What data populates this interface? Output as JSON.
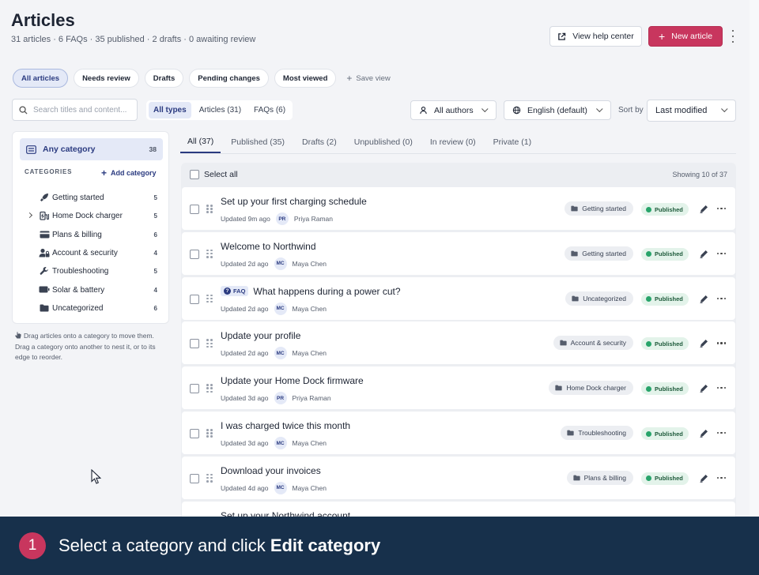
{
  "header": {
    "title": "Articles",
    "subtitle": "31 articles · 6 FAQs · 35 published · 2 drafts · 0 awaiting review",
    "help_label": "View help center",
    "new_label": "New article"
  },
  "views": {
    "items": [
      "All articles",
      "Needs review",
      "Drafts",
      "Pending changes",
      "Most viewed"
    ],
    "active": "All articles",
    "save_label": "Save view"
  },
  "filters": {
    "search_placeholder": "Search titles and content...",
    "types": [
      "All types",
      "Articles (31)",
      "FAQs (6)"
    ],
    "authors": "All authors",
    "language": "English (default)",
    "sort_label": "Sort by",
    "sort_value": "Last modified"
  },
  "sidebar": {
    "any_label": "Any category",
    "any_count": "38",
    "categories_heading": "CATEGORIES",
    "add_label": "Add category",
    "items": [
      {
        "label": "Getting started",
        "count": "5",
        "icon": "rocket-icon"
      },
      {
        "label": "Home Dock charger",
        "count": "5",
        "icon": "charger-icon"
      },
      {
        "label": "Plans & billing",
        "count": "6",
        "icon": "credit-card-icon"
      },
      {
        "label": "Account & security",
        "count": "4",
        "icon": "user-lock-icon"
      },
      {
        "label": "Troubleshooting",
        "count": "5",
        "icon": "wrench-icon"
      },
      {
        "label": "Solar & battery",
        "count": "4",
        "icon": "battery-icon"
      },
      {
        "label": "Uncategorized",
        "count": "6",
        "icon": "folder-icon"
      }
    ],
    "drag_hint": "Drag articles onto a category to move them. Drag a category onto another to nest it, or to its edge to reorder."
  },
  "status_tabs": [
    "All (37)",
    "Published (35)",
    "Drafts (2)",
    "Unpublished (0)",
    "In review (0)",
    "Private (1)"
  ],
  "list": {
    "select_all": "Select all",
    "showing": "Showing 10 of 37",
    "rows": [
      {
        "title": "Set up your first charging schedule",
        "updated": "Updated 9m ago",
        "initials": "PR",
        "author": "Priya Raman",
        "category": "Getting started",
        "status": "Published",
        "faq": false
      },
      {
        "title": "Welcome to Northwind",
        "updated": "Updated 2d ago",
        "initials": "MC",
        "author": "Maya Chen",
        "category": "Getting started",
        "status": "Published",
        "faq": false
      },
      {
        "title": "What happens during a power cut?",
        "updated": "Updated 2d ago",
        "initials": "MC",
        "author": "Maya Chen",
        "category": "Uncategorized",
        "status": "Published",
        "faq": true,
        "faq_label": "FAQ"
      },
      {
        "title": "Update your profile",
        "updated": "Updated 2d ago",
        "initials": "MC",
        "author": "Maya Chen",
        "category": "Account & security",
        "status": "Published",
        "faq": false
      },
      {
        "title": "Update your Home Dock firmware",
        "updated": "Updated 3d ago",
        "initials": "PR",
        "author": "Priya Raman",
        "category": "Home Dock charger",
        "status": "Published",
        "faq": false
      },
      {
        "title": "I was charged twice this month",
        "updated": "Updated 3d ago",
        "initials": "MC",
        "author": "Maya Chen",
        "category": "Troubleshooting",
        "status": "Published",
        "faq": false
      },
      {
        "title": "Download your invoices",
        "updated": "Updated 4d ago",
        "initials": "MC",
        "author": "Maya Chen",
        "category": "Plans & billing",
        "status": "Published",
        "faq": false
      },
      {
        "title": "Set up your Northwind account",
        "updated": "",
        "initials": "",
        "author": "",
        "category": "",
        "status": "",
        "faq": false
      }
    ]
  },
  "banner": {
    "step": "1",
    "text_prefix": "Select a category and click ",
    "text_bold": "Edit category"
  },
  "colors": {
    "accent": "#c8365e",
    "primary": "#2b3b80",
    "banner_bg": "#17304b",
    "published": "#28a46a"
  }
}
